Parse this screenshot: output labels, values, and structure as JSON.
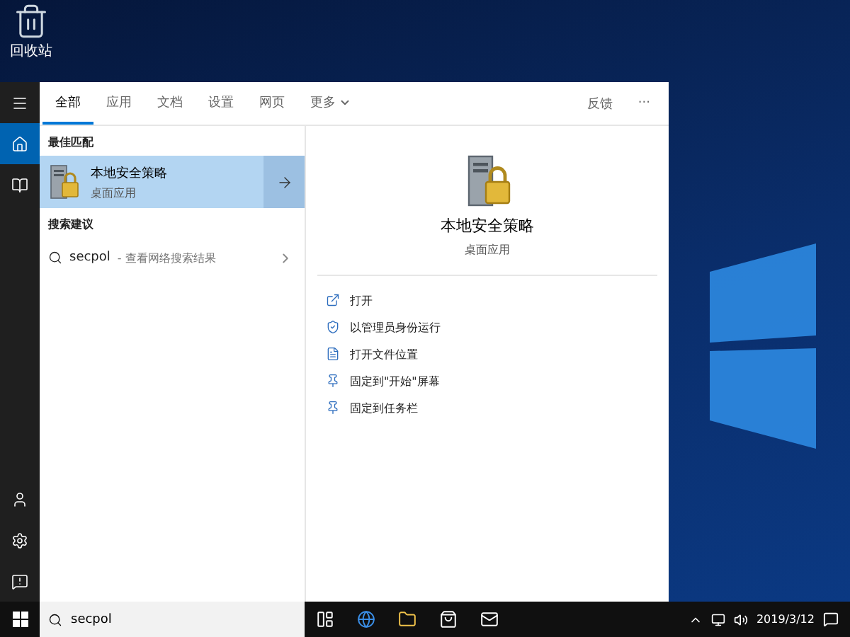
{
  "desktop": {
    "icons": [
      {
        "label": "回收站"
      }
    ]
  },
  "rail": {
    "top": [
      {
        "kind": "menu",
        "selected": false
      },
      {
        "kind": "home",
        "selected": true
      },
      {
        "kind": "notebook",
        "selected": false
      }
    ],
    "bottom": [
      {
        "kind": "user"
      },
      {
        "kind": "settings"
      },
      {
        "kind": "feedback"
      }
    ]
  },
  "tabs": [
    {
      "label": "全部",
      "selected": true,
      "kind": "tab"
    },
    {
      "label": "应用",
      "selected": false,
      "kind": "tab"
    },
    {
      "label": "文档",
      "selected": false,
      "kind": "tab"
    },
    {
      "label": "设置",
      "selected": false,
      "kind": "tab"
    },
    {
      "label": "网页",
      "selected": false,
      "kind": "tab"
    },
    {
      "label": "更多",
      "selected": false,
      "kind": "dropdown"
    }
  ],
  "toolbar": {
    "feedback": "反馈",
    "more": "···"
  },
  "best_match": {
    "heading": "最佳匹配",
    "title": "本地安全策略",
    "subtitle": "桌面应用",
    "selected": true
  },
  "suggestions": {
    "heading": "搜索建议",
    "items": [
      {
        "query": "secpol",
        "hint": "- 查看网络搜索结果"
      }
    ]
  },
  "detail": {
    "title": "本地安全策略",
    "subtitle": "桌面应用",
    "actions": [
      {
        "kind": "open",
        "label": "打开"
      },
      {
        "kind": "admin",
        "label": "以管理员身份运行"
      },
      {
        "kind": "location",
        "label": "打开文件位置"
      },
      {
        "kind": "pin",
        "label": "固定到\"开始\"屏幕"
      },
      {
        "kind": "pin",
        "label": "固定到任务栏"
      }
    ]
  },
  "search_box": {
    "value": "secpol"
  },
  "taskbar": {
    "apps": [
      {
        "kind": "task-view"
      },
      {
        "kind": "browser"
      },
      {
        "kind": "folder"
      },
      {
        "kind": "store"
      },
      {
        "kind": "mail"
      }
    ],
    "date": "2019/3/12"
  }
}
